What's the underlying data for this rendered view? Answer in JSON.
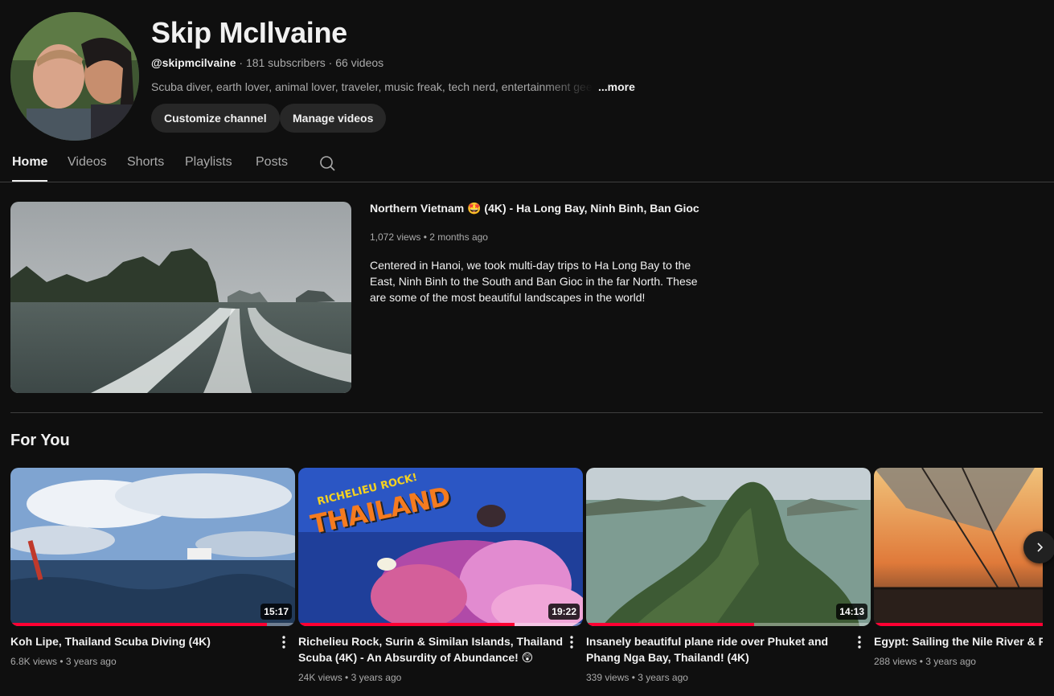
{
  "channel": {
    "name": "Skip McIlvaine",
    "handle": "@skipmcilvaine",
    "subscribers": "181 subscribers",
    "videos": "66 videos",
    "description": "Scuba diver, earth lover, animal lover, traveler, music freak, tech nerd, entertainment geek, and",
    "more_label": "...more",
    "separator": " · "
  },
  "buttons": {
    "customize": "Customize channel",
    "manage": "Manage videos"
  },
  "tabs": [
    {
      "label": "Home",
      "active": true
    },
    {
      "label": "Videos",
      "active": false
    },
    {
      "label": "Shorts",
      "active": false
    },
    {
      "label": "Playlists",
      "active": false
    },
    {
      "label": "Posts",
      "active": false
    }
  ],
  "featured": {
    "title": "Northern Vietnam 🤩 (4K) - Ha Long Bay, Ninh Binh, Ban Gioc",
    "views": "1,072 views",
    "age": "2 months ago",
    "meta_sep": " • ",
    "description": "Centered in Hanoi, we took multi-day trips to Ha Long Bay to the East, Ninh Binh to the South and Ban Gioc in the far North. These are some of the most beautiful landscapes in the world!"
  },
  "section": {
    "title": "For You"
  },
  "videos": [
    {
      "title": "Koh Lipe, Thailand Scuba Diving (4K)",
      "duration": "15:17",
      "views": "6.8K views",
      "age": "3 years ago",
      "progress": 0.9
    },
    {
      "title": "Richelieu Rock, Surin & Similan Islands, Thailand Scuba (4K) - An Absurdity of Abundance! 😲",
      "duration": "19:22",
      "views": "24K views",
      "age": "3 years ago",
      "progress": 0.76,
      "thumb_text": "RICHELIEU ROCK!",
      "thumb_big": "THAILAND"
    },
    {
      "title": "Insanely beautiful plane ride over Phuket and Phang Nga Bay, Thailand! (4K)",
      "duration": "14:13",
      "views": "339 views",
      "age": "3 years ago",
      "progress": 0.59
    },
    {
      "title": "Egypt: Sailing the Nile River & Red",
      "duration": "",
      "views": "288 views",
      "age": "3 years ago",
      "progress": 1.0
    }
  ],
  "icons": {
    "search": "search-icon",
    "kebab": "more-vert-icon",
    "next": "chevron-right-icon"
  }
}
